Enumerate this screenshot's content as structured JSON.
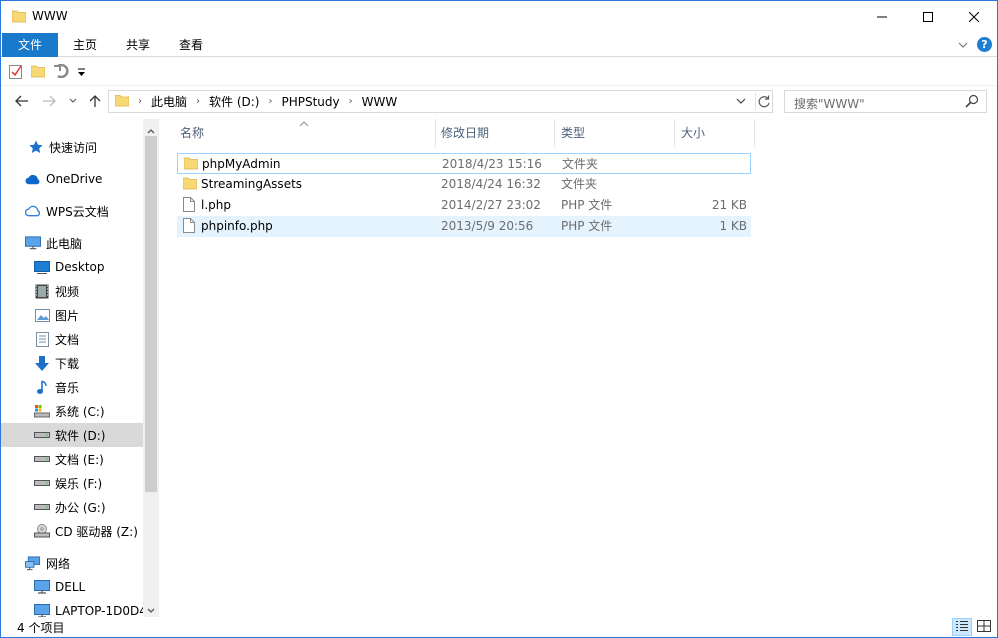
{
  "window": {
    "title": "WWW"
  },
  "ribbon": {
    "tabs": [
      "文件",
      "主页",
      "共享",
      "查看"
    ]
  },
  "address": {
    "crumbs": [
      "此电脑",
      "软件 (D:)",
      "PHPStudy",
      "WWW"
    ]
  },
  "search": {
    "placeholder": "搜索\"WWW\""
  },
  "nav": {
    "items": [
      {
        "label": "快速访问",
        "icon": "star-icon"
      },
      {
        "label": "OneDrive",
        "icon": "cloud-icon"
      },
      {
        "label": "WPS云文档",
        "icon": "wps-cloud-icon"
      },
      {
        "label": "此电脑",
        "icon": "computer-icon"
      },
      {
        "label": "Desktop",
        "icon": "desktop-icon"
      },
      {
        "label": "视频",
        "icon": "video-icon"
      },
      {
        "label": "图片",
        "icon": "pictures-icon"
      },
      {
        "label": "文档",
        "icon": "documents-icon"
      },
      {
        "label": "下载",
        "icon": "download-icon"
      },
      {
        "label": "音乐",
        "icon": "music-icon"
      },
      {
        "label": "系统 (C:)",
        "icon": "system-drive-icon"
      },
      {
        "label": "软件 (D:)",
        "icon": "drive-icon"
      },
      {
        "label": "文档 (E:)",
        "icon": "drive-icon"
      },
      {
        "label": "娱乐 (F:)",
        "icon": "drive-icon"
      },
      {
        "label": "办公 (G:)",
        "icon": "drive-icon"
      },
      {
        "label": "CD 驱动器 (Z:)",
        "icon": "cd-drive-icon"
      },
      {
        "label": "网络",
        "icon": "network-icon"
      },
      {
        "label": "DELL",
        "icon": "network-computer-icon"
      },
      {
        "label": "LAPTOP-1D0D4",
        "icon": "network-computer-icon"
      }
    ]
  },
  "columns": {
    "name": "名称",
    "date": "修改日期",
    "type": "类型",
    "size": "大小"
  },
  "files": [
    {
      "name": "phpMyAdmin",
      "date": "2018/4/23 15:16",
      "type": "文件夹",
      "size": "",
      "icon": "folder-icon"
    },
    {
      "name": "StreamingAssets",
      "date": "2018/4/24 16:32",
      "type": "文件夹",
      "size": "",
      "icon": "folder-icon"
    },
    {
      "name": "l.php",
      "date": "2014/2/27 23:02",
      "type": "PHP 文件",
      "size": "21 KB",
      "icon": "file-icon"
    },
    {
      "name": "phpinfo.php",
      "date": "2013/5/9 20:56",
      "type": "PHP 文件",
      "size": "1 KB",
      "icon": "file-icon"
    }
  ],
  "status": {
    "count": "4 个项目"
  },
  "colors": {
    "accent": "#1979ca",
    "selection": "#cce8ff",
    "hover": "#e5f3ff",
    "folder": "#f8d775"
  }
}
